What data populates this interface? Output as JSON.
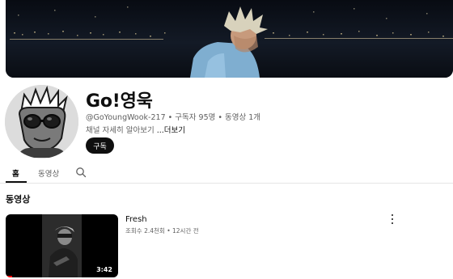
{
  "banner": {
    "description_icon": "night-city-photo"
  },
  "channel": {
    "name": "Go!영욱",
    "handle": "@GoYoungWook-217",
    "separator1": " • ",
    "subscribers": "구독자 95명",
    "separator2": " • ",
    "video_count": "동영상 1개",
    "description": "채널 자세히 알아보기 ",
    "more_label": "...더보기",
    "subscribe_label": "구독"
  },
  "tabs": {
    "home": "홈",
    "videos": "동영상",
    "search_icon": "search-icon"
  },
  "section": {
    "title": "동영상"
  },
  "video": {
    "title": "Fresh",
    "views": "조회수 2.4천회",
    "dot": " • ",
    "age": "12시간 전",
    "duration": "3:42",
    "watched_fraction": 0.06
  },
  "colors": {
    "accent": "#ff0000",
    "subscribe_bg": "#0f0f0f"
  }
}
